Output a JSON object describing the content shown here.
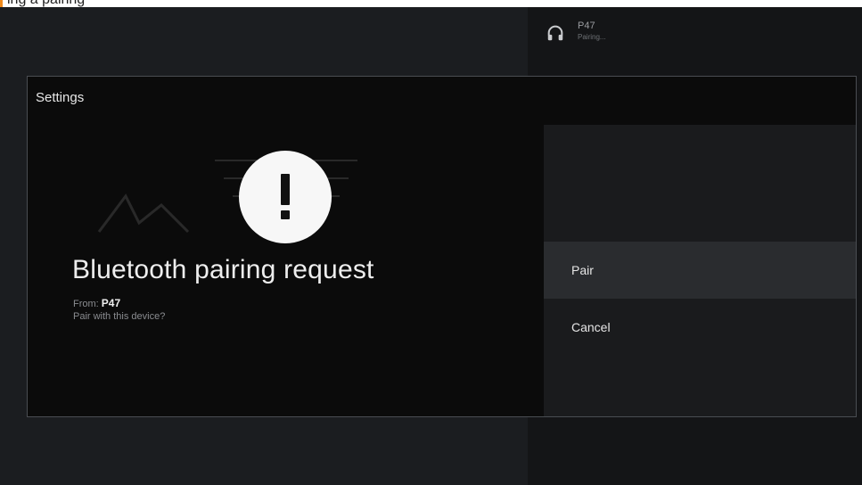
{
  "top_strip": {
    "caption": "ing a pairing"
  },
  "notification": {
    "device_name": "P47",
    "status": "Pairing..."
  },
  "dialog": {
    "title": "Settings",
    "request_title": "Bluetooth pairing request",
    "from_label": "From:",
    "from_device": "P47",
    "question": "Pair with this device?"
  },
  "actions": {
    "pair_label": "Pair",
    "cancel_label": "Cancel"
  },
  "colors": {
    "accent": "#f08a1c",
    "dialog_bg": "#0b0b0b",
    "action_panel_bg": "#1a1b1d",
    "focused_bg": "#2a2c2f"
  },
  "icons": {
    "notification": "headphones-icon",
    "alert": "exclamation-icon"
  }
}
